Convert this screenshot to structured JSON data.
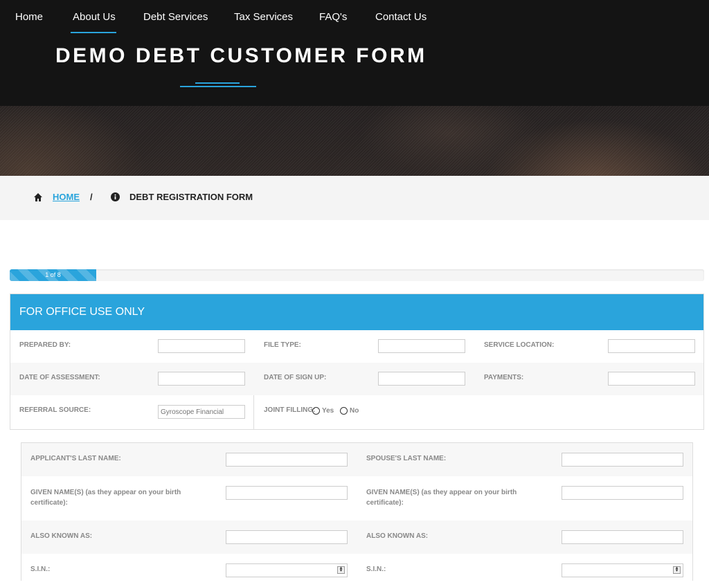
{
  "nav": {
    "items": [
      "Home",
      "About Us",
      "Debt Services",
      "Tax Services",
      "FAQ's",
      "Contact Us"
    ],
    "active": "About Us"
  },
  "hero": {
    "title": "DEMO DEBT CUSTOMER FORM"
  },
  "breadcrumb": {
    "home": "HOME",
    "separator": "/",
    "current": "DEBT REGISTRATION FORM"
  },
  "progress": {
    "label": "1 of 8",
    "step": 1,
    "total": 8
  },
  "office": {
    "title": "FOR OFFICE USE ONLY",
    "prepared_by": "PREPARED BY:",
    "file_type": "FILE TYPE:",
    "service_location": "SERVICE LOCATION:",
    "date_of_assessment": "DATE OF ASSESSMENT:",
    "date_of_sign_up": "DATE OF SIGN UP:",
    "payments": "PAYMENTS:",
    "referral_source": "REFERRAL SOURCE:",
    "referral_placeholder": "Gyroscope Financial",
    "joint_filling": "JOINT FILLING:",
    "yes": "Yes",
    "no": "No"
  },
  "applicant": {
    "last_name": "APPLICANT'S LAST NAME:",
    "given_names": "GIVEN NAME(S) (as they appear on your birth certificate):",
    "aka": "ALSO KNOWN AS:",
    "sin": "S.I.N.:"
  },
  "spouse": {
    "last_name": "SPOUSE'S LAST NAME:",
    "given_names": "GIVEN NAME(S) (as they appear on your birth certificate):",
    "aka": "ALSO KNOWN AS:",
    "sin": "S.I.N.:"
  },
  "colors": {
    "accent": "#2aa4dc",
    "hero_bg": "#141414",
    "label": "#888888"
  }
}
